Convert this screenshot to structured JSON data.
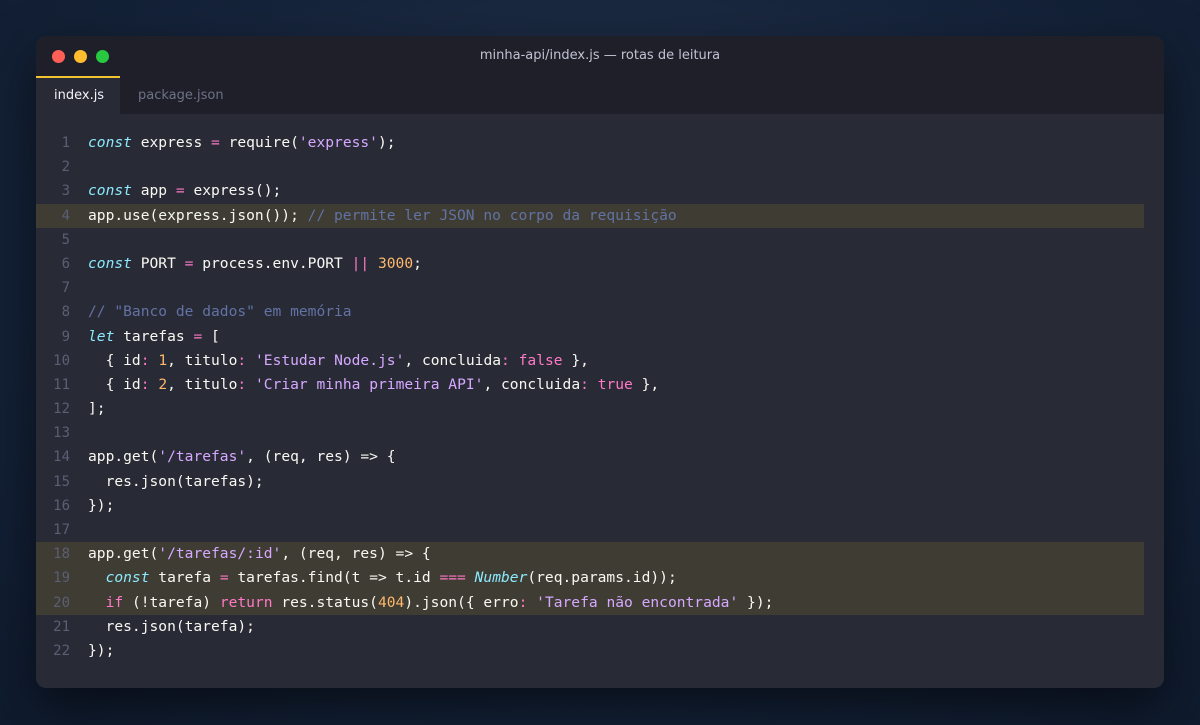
{
  "window": {
    "title": "minha-api/index.js — rotas de leitura",
    "traffic_lights": [
      {
        "name": "close",
        "color": "#ff5f57"
      },
      {
        "name": "minimize",
        "color": "#febc2e"
      },
      {
        "name": "maximize",
        "color": "#28c840"
      }
    ]
  },
  "tabs": [
    {
      "label": "index.js",
      "active": true
    },
    {
      "label": "package.json",
      "active": false
    }
  ],
  "colors": {
    "background": "#282a36",
    "highlight": "#3e3c33",
    "tab_accent": "#f1c232",
    "keyword": "#8be9fd",
    "string": "#d6a8ff",
    "number": "#ffb86c",
    "operator": "#ff79c6",
    "comment": "#6272a4"
  },
  "editor": {
    "highlighted_lines": [
      4,
      18,
      19,
      20
    ],
    "lines": [
      {
        "n": "1",
        "tokens": [
          [
            "kw",
            "const"
          ],
          [
            "p",
            " express "
          ],
          [
            "op",
            "="
          ],
          [
            "p",
            " require("
          ],
          [
            "str",
            "'express'"
          ],
          [
            "p",
            ");"
          ]
        ]
      },
      {
        "n": "2",
        "tokens": []
      },
      {
        "n": "3",
        "tokens": [
          [
            "kw",
            "const"
          ],
          [
            "p",
            " app "
          ],
          [
            "op",
            "="
          ],
          [
            "p",
            " express();"
          ]
        ]
      },
      {
        "n": "4",
        "tokens": [
          [
            "p",
            "app.use(express.json()); "
          ],
          [
            "com",
            "// permite ler JSON no corpo da requisição"
          ]
        ]
      },
      {
        "n": "5",
        "tokens": []
      },
      {
        "n": "6",
        "tokens": [
          [
            "kw",
            "const"
          ],
          [
            "p",
            " PORT "
          ],
          [
            "op",
            "="
          ],
          [
            "p",
            " process.env.PORT "
          ],
          [
            "op",
            "||"
          ],
          [
            "p",
            " "
          ],
          [
            "num",
            "3000"
          ],
          [
            "p",
            ";"
          ]
        ]
      },
      {
        "n": "7",
        "tokens": []
      },
      {
        "n": "8",
        "tokens": [
          [
            "com",
            "// \"Banco de dados\" em memória"
          ]
        ]
      },
      {
        "n": "9",
        "tokens": [
          [
            "kw",
            "let"
          ],
          [
            "p",
            " tarefas "
          ],
          [
            "op",
            "="
          ],
          [
            "p",
            " ["
          ]
        ]
      },
      {
        "n": "10",
        "tokens": [
          [
            "p",
            "  { id"
          ],
          [
            "op",
            ":"
          ],
          [
            "p",
            " "
          ],
          [
            "num",
            "1"
          ],
          [
            "p",
            ", titulo"
          ],
          [
            "op",
            ":"
          ],
          [
            "p",
            " "
          ],
          [
            "str",
            "'Estudar Node.js'"
          ],
          [
            "p",
            ", concluida"
          ],
          [
            "op",
            ":"
          ],
          [
            "p",
            " "
          ],
          [
            "bool",
            "false"
          ],
          [
            "p",
            " },"
          ]
        ]
      },
      {
        "n": "11",
        "tokens": [
          [
            "p",
            "  { id"
          ],
          [
            "op",
            ":"
          ],
          [
            "p",
            " "
          ],
          [
            "num",
            "2"
          ],
          [
            "p",
            ", titulo"
          ],
          [
            "op",
            ":"
          ],
          [
            "p",
            " "
          ],
          [
            "str",
            "'Criar minha primeira API'"
          ],
          [
            "p",
            ", concluida"
          ],
          [
            "op",
            ":"
          ],
          [
            "p",
            " "
          ],
          [
            "bool",
            "true"
          ],
          [
            "p",
            " },"
          ]
        ]
      },
      {
        "n": "12",
        "tokens": [
          [
            "p",
            "];"
          ]
        ]
      },
      {
        "n": "13",
        "tokens": []
      },
      {
        "n": "14",
        "tokens": [
          [
            "p",
            "app.get("
          ],
          [
            "str",
            "'/tarefas'"
          ],
          [
            "p",
            ", (req, res) => {"
          ]
        ]
      },
      {
        "n": "15",
        "tokens": [
          [
            "p",
            "  res.json(tarefas);"
          ]
        ]
      },
      {
        "n": "16",
        "tokens": [
          [
            "p",
            "});"
          ]
        ]
      },
      {
        "n": "17",
        "tokens": []
      },
      {
        "n": "18",
        "tokens": [
          [
            "p",
            "app.get("
          ],
          [
            "str",
            "'/tarefas/:id'"
          ],
          [
            "p",
            ", (req, res) => {"
          ]
        ]
      },
      {
        "n": "19",
        "tokens": [
          [
            "p",
            "  "
          ],
          [
            "kw",
            "const"
          ],
          [
            "p",
            " tarefa "
          ],
          [
            "op",
            "="
          ],
          [
            "p",
            " tarefas.find(t => t.id "
          ],
          [
            "op",
            "==="
          ],
          [
            "p",
            " "
          ],
          [
            "kw",
            "Number"
          ],
          [
            "p",
            "(req.params.id));"
          ]
        ]
      },
      {
        "n": "20",
        "tokens": [
          [
            "p",
            "  "
          ],
          [
            "ctrl",
            "if"
          ],
          [
            "p",
            " (!tarefa) "
          ],
          [
            "ctrl",
            "return"
          ],
          [
            "p",
            " res.status("
          ],
          [
            "num",
            "404"
          ],
          [
            "p",
            ").json({ erro"
          ],
          [
            "op",
            ":"
          ],
          [
            "p",
            " "
          ],
          [
            "str",
            "'Tarefa não encontrada'"
          ],
          [
            "p",
            " });"
          ]
        ]
      },
      {
        "n": "21",
        "tokens": [
          [
            "p",
            "  res.json(tarefa);"
          ]
        ]
      },
      {
        "n": "22",
        "tokens": [
          [
            "p",
            "});"
          ]
        ]
      }
    ]
  }
}
